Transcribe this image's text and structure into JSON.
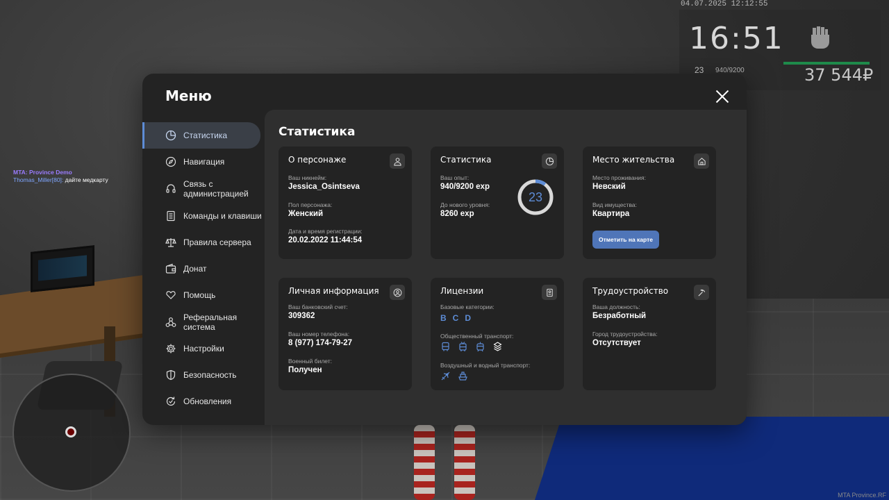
{
  "hud": {
    "datetime": "04.07.2025 12:12:55",
    "time": "16:51",
    "level": "23",
    "exp": "940/9200",
    "money": "37 544₽",
    "watermark": "MTA Province.RF"
  },
  "chat": {
    "line1": "MTA: Province Demo",
    "line2_name": "Thomas_Miller[80]:",
    "line2_msg": " дайте медкарту"
  },
  "menu": {
    "title": "Меню",
    "sidebar": [
      {
        "label": "Статистика",
        "icon": "pie-chart-icon"
      },
      {
        "label": "Навигация",
        "icon": "compass-icon"
      },
      {
        "label": "Связь с администрацией",
        "icon": "headset-icon"
      },
      {
        "label": "Команды и клавиши",
        "icon": "document-icon"
      },
      {
        "label": "Правила сервера",
        "icon": "scales-icon"
      },
      {
        "label": "Донат",
        "icon": "wallet-icon"
      },
      {
        "label": "Помощь",
        "icon": "heart-hand-icon"
      },
      {
        "label": "Реферальная система",
        "icon": "network-icon"
      },
      {
        "label": "Настройки",
        "icon": "gear-icon"
      },
      {
        "label": "Безопасность",
        "icon": "shield-icon"
      },
      {
        "label": "Обновления",
        "icon": "refresh-icon"
      }
    ]
  },
  "content": {
    "title": "Статистика",
    "about": {
      "title": "О персонаже",
      "nick_label": "Ваш никнейм:",
      "nick": "Jessica_Osintseva",
      "gender_label": "Пол персонажа:",
      "gender": "Женский",
      "reg_label": "Дата и время регистрации:",
      "reg": "20.02.2022 11:44:54"
    },
    "stats": {
      "title": "Статистика",
      "exp_label": "Ваш опыт:",
      "exp": "940/9200 exp",
      "next_label": "До нового уровня:",
      "next": "8260 exp",
      "level": "23",
      "progress": 0.102
    },
    "residence": {
      "title": "Место жительства",
      "place_label": "Место проживания:",
      "place": "Невский",
      "property_label": "Вид имущества:",
      "property": "Квартира",
      "button": "Отметить на карте"
    },
    "personal": {
      "title": "Личная информация",
      "bank_label": "Ваш банковский счет:",
      "bank": "309362",
      "phone_label": "Ваш номер телефона:",
      "phone": "8 (977) 174-79-27",
      "military_label": "Военный билет:",
      "military": "Получен"
    },
    "licenses": {
      "title": "Лицензии",
      "base_label": "Базовые категории:",
      "categories": [
        "B",
        "C",
        "D"
      ],
      "public_label": "Общественный транспорт:",
      "public_icons": [
        "bus-icon",
        "trolleybus-icon",
        "tram-icon",
        "metro-icon"
      ],
      "air_label": "Воздушный и водный транспорт:",
      "air_icons": [
        "plane-icon",
        "ship-icon"
      ]
    },
    "job": {
      "title": "Трудоустройство",
      "position_label": "Ваша должность:",
      "position": "Безработный",
      "city_label": "Город трудоустройства:",
      "city": "Отсутствует"
    }
  },
  "colors": {
    "accent": "#5d8cd6",
    "button": "#4f75b8",
    "card": "#232323",
    "panel": "#2f2f2f"
  }
}
